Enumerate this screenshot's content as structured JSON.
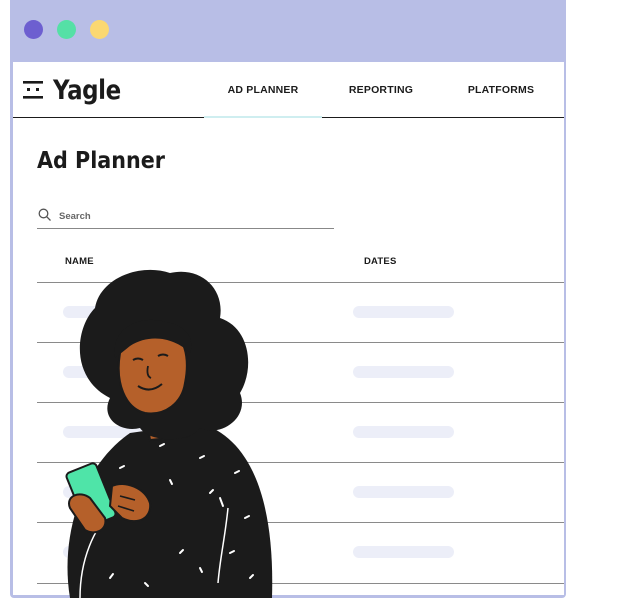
{
  "window": {
    "frame_color": "#b8bee6",
    "controls": [
      {
        "name": "close-dot",
        "color": "#6d5fd0"
      },
      {
        "name": "minimize-dot",
        "color": "#55e0a6"
      },
      {
        "name": "maximize-dot",
        "color": "#fbd872"
      }
    ]
  },
  "header": {
    "logo_text": "Yagle",
    "logo_icon": "face-icon",
    "tabs": [
      {
        "label": "AD PLANNER",
        "active": true
      },
      {
        "label": "REPORTING",
        "active": false
      },
      {
        "label": "PLATFORMS",
        "active": false
      }
    ]
  },
  "main": {
    "title": "Ad Planner",
    "search": {
      "placeholder": "Search",
      "value": "",
      "icon": "search-icon"
    },
    "table": {
      "columns": [
        "NAME",
        "DATES"
      ],
      "row_count": 5,
      "rows_loading": true
    }
  },
  "illustration": {
    "subject": "person-holding-phone",
    "colors": {
      "hair": "#1b1b1b",
      "skin": "#b5602a",
      "phone": "#4fe4a8",
      "sweater": "#1b1b1b"
    }
  },
  "colors": {
    "accent_tab_underline": "#cfeef0",
    "placeholder_bar": "#eceef8",
    "text": "#1b1b1b"
  }
}
